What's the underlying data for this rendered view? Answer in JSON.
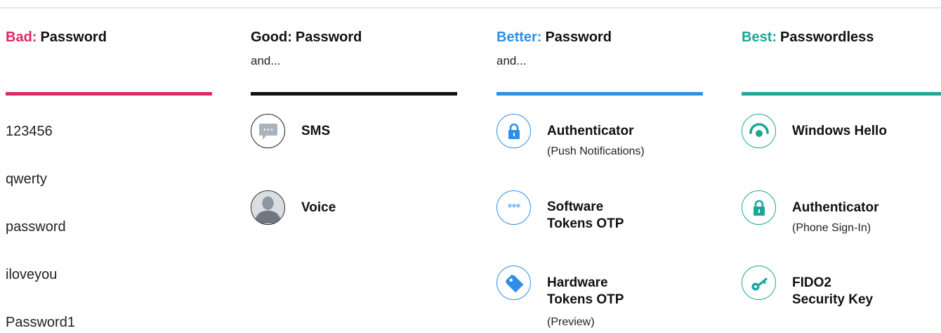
{
  "columns": {
    "bad": {
      "rank": "Bad:",
      "title": "Password",
      "rank_color": "#dc2b61",
      "bar_color": "#dc2b61",
      "passwords": [
        "123456",
        "qwerty",
        "password",
        "iloveyou",
        "Password1"
      ]
    },
    "good": {
      "rank": "Good:",
      "title": "Password",
      "subtitle": "and...",
      "bar_color": "#111111",
      "items": [
        {
          "icon": "sms-chat-icon",
          "label": "SMS"
        },
        {
          "icon": "person-avatar-icon",
          "label": "Voice"
        }
      ]
    },
    "better": {
      "rank": "Better:",
      "title": "Password",
      "subtitle": "and...",
      "rank_color": "#2f8fe6",
      "bar_color": "#2f8fe6",
      "items": [
        {
          "icon": "lock-icon",
          "label": "Authenticator",
          "note": "(Push Notifications)"
        },
        {
          "icon": "asterisks-icon",
          "icon_text": "***",
          "label_line1": "Software",
          "label_line2": "Tokens OTP"
        },
        {
          "icon": "hardware-token-tag-icon",
          "label_line1": "Hardware",
          "label_line2": "Tokens OTP",
          "note": "(Preview)"
        }
      ]
    },
    "best": {
      "rank": "Best:",
      "title": "Passwordless",
      "rank_color": "#1ba79a",
      "bar_color": "#1ba79a",
      "items": [
        {
          "icon": "windows-hello-icon",
          "label": "Windows Hello"
        },
        {
          "icon": "lock-icon",
          "label": "Authenticator",
          "note": "(Phone Sign-In)"
        },
        {
          "icon": "key-icon",
          "label_line1": "FIDO2",
          "label_line2": "Security Key"
        }
      ]
    }
  }
}
